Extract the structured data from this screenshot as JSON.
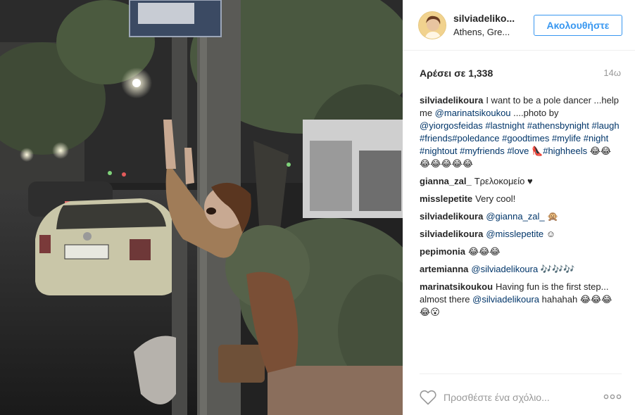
{
  "post": {
    "username": "silviadeliko...",
    "location": "Athens, Gre...",
    "follow_label": "Ακολουθήστε",
    "likes": "Αρέσει σε 1,338",
    "time": "14ω"
  },
  "caption": {
    "author": "silviadelikoura",
    "segments": [
      {
        "text": "I want to be a pole dancer ...help me ",
        "tag": false
      },
      {
        "text": "@marinatsikoukou",
        "tag": true
      },
      {
        "text": " ....photo by ",
        "tag": false
      },
      {
        "text": "@yiorgosfeidas",
        "tag": true
      },
      {
        "text": " ",
        "tag": false
      },
      {
        "text": "#lastnight",
        "tag": true
      },
      {
        "text": " ",
        "tag": false
      },
      {
        "text": "#athensbynight",
        "tag": true
      },
      {
        "text": " ",
        "tag": false
      },
      {
        "text": "#laugh",
        "tag": true
      },
      {
        "text": " ",
        "tag": false
      },
      {
        "text": "#friends",
        "tag": true
      },
      {
        "text": "#poledance",
        "tag": true
      },
      {
        "text": " ",
        "tag": false
      },
      {
        "text": "#goodtimes",
        "tag": true
      },
      {
        "text": " ",
        "tag": false
      },
      {
        "text": "#mylife",
        "tag": true
      },
      {
        "text": " ",
        "tag": false
      },
      {
        "text": "#night",
        "tag": true
      },
      {
        "text": " ",
        "tag": false
      },
      {
        "text": "#nightout",
        "tag": true
      },
      {
        "text": " ",
        "tag": false
      },
      {
        "text": "#myfriends",
        "tag": true
      },
      {
        "text": " ",
        "tag": false
      },
      {
        "text": "#love",
        "tag": true
      },
      {
        "text": " 👠",
        "tag": false
      },
      {
        "text": "#highheels",
        "tag": true
      },
      {
        "text": " 😂😂😂😂😂😂😂",
        "tag": false
      }
    ]
  },
  "comments": [
    {
      "author": "gianna_zal_",
      "segments": [
        {
          "text": "Τρελοκομείο ♥",
          "tag": false
        }
      ]
    },
    {
      "author": "misslepetite",
      "segments": [
        {
          "text": "Very cool!",
          "tag": false
        }
      ]
    },
    {
      "author": "silviadelikoura",
      "segments": [
        {
          "text": "@gianna_zal_",
          "tag": true
        },
        {
          "text": " 🙊",
          "tag": false
        }
      ]
    },
    {
      "author": "silviadelikoura",
      "segments": [
        {
          "text": "@misslepetite",
          "tag": true
        },
        {
          "text": " ☺",
          "tag": false
        }
      ]
    },
    {
      "author": "pepimonia",
      "segments": [
        {
          "text": "😂😂😂",
          "tag": false
        }
      ]
    },
    {
      "author": "artemianna",
      "segments": [
        {
          "text": "@silviadelikoura",
          "tag": true
        },
        {
          "text": " 🎶🎶🎶",
          "tag": false
        }
      ]
    },
    {
      "author": "marinatsikoukou",
      "segments": [
        {
          "text": "Having fun is the first step... almost there ",
          "tag": false
        },
        {
          "text": "@silviadelikoura",
          "tag": true
        },
        {
          "text": " hahahah 😂😂😂😂😮",
          "tag": false
        }
      ]
    }
  ],
  "footer": {
    "comment_placeholder": "Προσθέστε ένα σχόλιο...",
    "heart_icon": "heart-outline-icon",
    "more_icon": "more-options-icon"
  },
  "colors": {
    "accent": "#3897f0",
    "tag": "#003569",
    "muted": "#999999"
  }
}
